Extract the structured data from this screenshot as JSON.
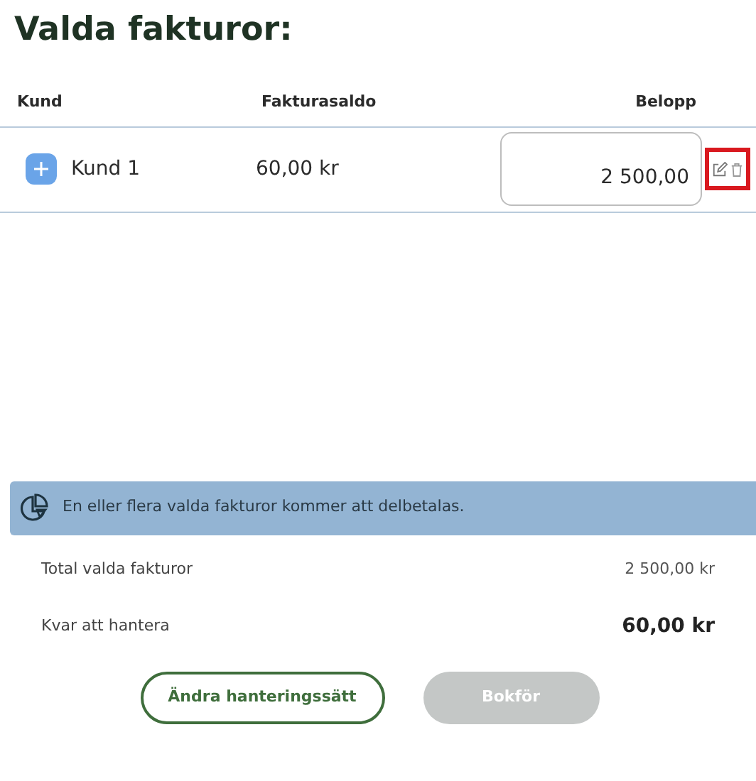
{
  "title": "Valda fakturor:",
  "table": {
    "columns": [
      "Kund",
      "Fakturasaldo",
      "Belopp"
    ],
    "rows": [
      {
        "customer": "Kund 1",
        "balance": "60,00 kr",
        "amount": "2 500,00",
        "actions_highlighted": true
      }
    ]
  },
  "banner": {
    "text": "En eller flera valda fakturor kommer att delbetalas."
  },
  "totals": [
    {
      "label": "Total valda fakturor",
      "value": "2 500,00 kr",
      "bold": false
    },
    {
      "label": "Kvar att hantera",
      "value": "60,00 kr",
      "bold": true
    }
  ],
  "buttons": [
    {
      "label": "Ändra hanteringssätt",
      "kind": "outline",
      "disabled": false
    },
    {
      "label": "Bokför",
      "kind": "filled",
      "disabled": true
    }
  ]
}
